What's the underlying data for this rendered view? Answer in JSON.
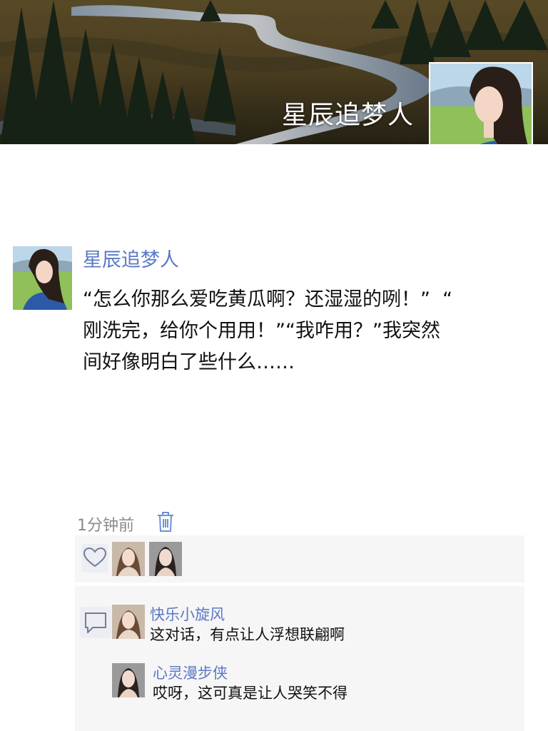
{
  "profile": {
    "cover_name": "星辰追梦人"
  },
  "post": {
    "author": "星辰追梦人",
    "text": "“怎么你那么爱吃黄瓜啊？还湿湿的咧！”  “\n刚洗完，给你个用用！”“我咋用？”我突然\n间好像明白了些什么……",
    "time": "1分钟前"
  },
  "likes": {
    "icon": "heart-outline-icon",
    "count_avatars": 2
  },
  "comments": [
    {
      "author": "快乐小旋风",
      "text": "这对话，有点让人浮想联翩啊"
    },
    {
      "author": "心灵漫步侠",
      "text": "哎呀，这可真是让人哭笑不得"
    }
  ],
  "colors": {
    "accent": "#5b78c6",
    "meta": "#8a8a8a",
    "panel": "#f6f6f6"
  }
}
